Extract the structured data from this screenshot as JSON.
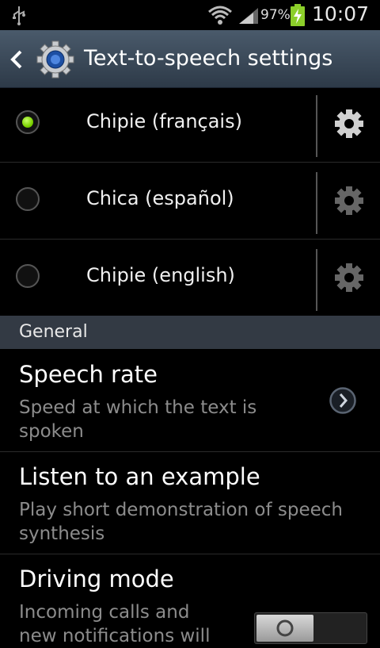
{
  "status_bar": {
    "battery_percent": "97%",
    "time": "10:07",
    "icons": [
      "usb-icon",
      "wifi-icon",
      "signal-icon",
      "battery-charging-icon"
    ]
  },
  "action_bar": {
    "title": "Text-to-speech settings",
    "back_icon": "chevron-left-icon",
    "app_icon": "settings-gear-icon"
  },
  "voices": [
    {
      "label": "Chipie (français)",
      "selected": true
    },
    {
      "label": "Chica (español)",
      "selected": false
    },
    {
      "label": "Chipie (english)",
      "selected": false
    }
  ],
  "general_section": {
    "header": "General",
    "speech_rate": {
      "title": "Speech rate",
      "subtitle_line1": "Speed at which the text is",
      "subtitle_line2": "spoken"
    },
    "listen_example": {
      "title": "Listen to an example",
      "subtitle_line1": "Play short demonstration of speech",
      "subtitle_line2": "synthesis"
    },
    "driving_mode": {
      "title": "Driving mode",
      "subtitle_line1": "Incoming calls and",
      "subtitle_line2": "new notifications will",
      "enabled": true
    }
  },
  "colors": {
    "accent_green": "#7cd200",
    "action_bar_top": "#4a5a6b",
    "section_header": "#333a44"
  }
}
